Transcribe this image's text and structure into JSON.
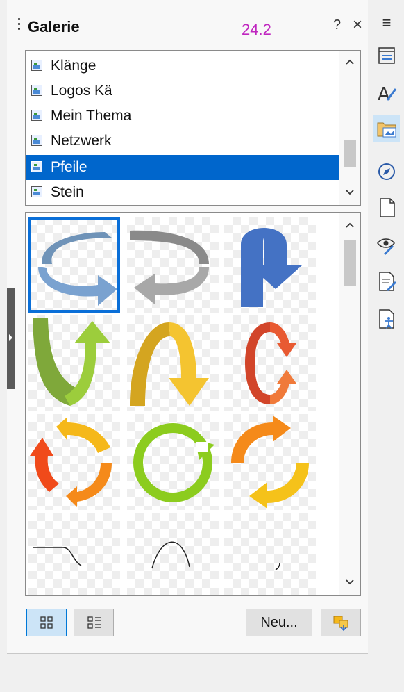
{
  "panel": {
    "title": "Galerie",
    "version": "24.2",
    "help_label": "?",
    "close_label": "×"
  },
  "menu_icon": "≡",
  "themes": {
    "items": [
      {
        "label": "Klänge"
      },
      {
        "label": "Logos Kä"
      },
      {
        "label": "Mein Thema"
      },
      {
        "label": "Netzwerk"
      },
      {
        "label": "Pfeile",
        "selected": true
      },
      {
        "label": "Stein"
      }
    ],
    "scroll_up": "▲",
    "scroll_down": "▼",
    "scroll_position": 0.7
  },
  "gallery": {
    "selected_index": 0,
    "items": [
      {
        "icon": "circular-arrow-blue-right"
      },
      {
        "icon": "circular-arrow-gray-left"
      },
      {
        "icon": "u-turn-arrow-blue"
      },
      {
        "icon": "u-arrow-green-up"
      },
      {
        "icon": "arch-arrow-yellow-down"
      },
      {
        "icon": "loop-arrow-red"
      },
      {
        "icon": "cycle-arrows-orange"
      },
      {
        "icon": "circle-arrow-green"
      },
      {
        "icon": "cycle-arrows-orange-yellow"
      },
      {
        "icon": "line-curve-down"
      },
      {
        "icon": "line-arch"
      },
      {
        "icon": "line-small-curve"
      }
    ],
    "scroll_position": 0.0
  },
  "bottom": {
    "icon_view": "icon-view",
    "detail_view": "detail-view",
    "new_label": "Neu...",
    "properties": "theme-properties-icon"
  },
  "sidebar_tabs": [
    {
      "icon": "properties-icon"
    },
    {
      "icon": "styles-icon"
    },
    {
      "icon": "gallery-icon",
      "active": true
    },
    {
      "icon": "navigator-icon"
    },
    {
      "icon": "page-icon"
    },
    {
      "icon": "style-inspector-icon"
    },
    {
      "icon": "manage-changes-icon"
    },
    {
      "icon": "accessibility-check-icon"
    }
  ]
}
